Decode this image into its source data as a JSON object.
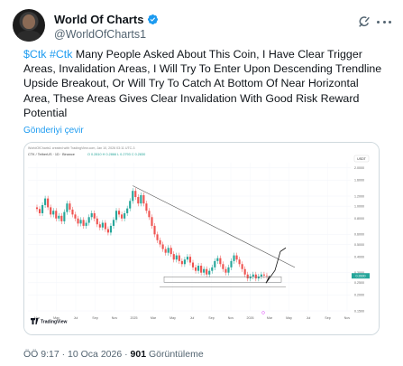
{
  "tweet": {
    "author_name": "World Of Charts",
    "handle": "@WorldOfCharts1",
    "hashtags": [
      "$Ctk",
      "#Ctk"
    ],
    "body": "Many People Asked About This Coin, I Have Clear Trigger Areas, Invalidation Areas, I Will Try To Enter Upon Descending Trendline Upside Breakout, Or Will Try To Catch At Bottom Of Near Horizontal Area, These Areas Gives Clear Invalidation With Good Risk Reward Potential",
    "translate_label": "Gönderiyi çevir",
    "time": "ÖÖ 9:17",
    "date": "10 Oca 2026",
    "views_count": "901",
    "views_label": "Görüntüleme",
    "separator": "·"
  },
  "icons": {
    "verified": "verified-badge-icon",
    "grok": "grok-icon",
    "more": "more-icon"
  },
  "colors": {
    "accent": "#1d9bf0",
    "up_candle": "#26a69a",
    "down_candle": "#ef5350",
    "trendline": "#555555",
    "projection": "#111111"
  },
  "chart_data": {
    "type": "candlestick",
    "header_text": "WorldOfCharts1 created with TradingView.com, Jan 10, 2026 03:11 UTC-3",
    "symbol_line": "CTK / TetherUS · 1D · Binance",
    "ohlc_readout": "O 0.2810  H 0.2866  L 0.2793  C 0.2830",
    "currency_badge": "USDT",
    "price_badge": "0.2830",
    "x_labels": [
      "Mar",
      "May",
      "Jul",
      "Sep",
      "Nov",
      "2025",
      "Mar",
      "May",
      "Jul",
      "Sep",
      "Nov",
      "2026",
      "Mar",
      "May",
      "Jul",
      "Sep",
      "Nov"
    ],
    "y_labels": [
      "2.0000",
      "1.6000",
      "1.2000",
      "1.0000",
      "0.8000",
      "0.6000",
      "0.5000",
      "0.4000",
      "0.3000",
      "0.2500",
      "0.2000",
      "0.1500"
    ],
    "ylim": [
      0.15,
      2.2
    ],
    "log_scale": true,
    "closes": [
      0.95,
      0.88,
      1.02,
      1.15,
      0.98,
      0.86,
      0.92,
      0.8,
      0.84,
      0.76,
      0.9,
      1.05,
      0.94,
      0.86,
      0.8,
      0.73,
      0.78,
      0.7,
      0.74,
      0.82,
      0.88,
      0.8,
      0.72,
      0.68,
      0.74,
      0.66,
      0.62,
      0.7,
      0.78,
      0.92,
      0.86,
      0.8,
      0.88,
      0.96,
      1.1,
      1.32,
      1.18,
      1.05,
      1.22,
      1.05,
      0.92,
      0.82,
      0.7,
      0.6,
      0.54,
      0.5,
      0.46,
      0.43,
      0.47,
      0.42,
      0.38,
      0.41,
      0.37,
      0.35,
      0.38,
      0.4,
      0.36,
      0.33,
      0.31,
      0.34,
      0.3,
      0.32,
      0.29,
      0.31,
      0.33,
      0.37,
      0.39,
      0.35,
      0.32,
      0.3,
      0.33,
      0.37,
      0.41,
      0.38,
      0.35,
      0.32,
      0.29,
      0.27,
      0.28,
      0.29,
      0.27,
      0.28,
      0.29,
      0.285,
      0.283
    ],
    "annotations": {
      "descending_trendline": {
        "from_price": 1.45,
        "to_price": 0.33
      },
      "horizontal_zone_price": 0.265,
      "projection_target_price": 0.47
    },
    "watermark": "TradingView"
  }
}
